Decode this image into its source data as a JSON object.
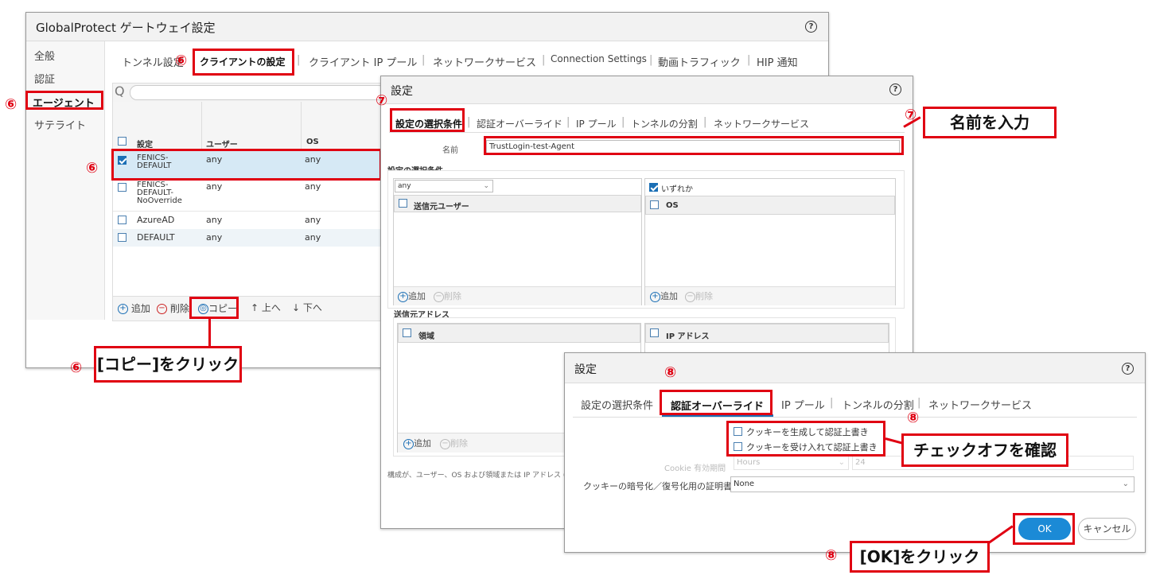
{
  "main_window": {
    "title": "GlobalProtect ゲートウェイ設定",
    "help": "?",
    "sidebar": [
      "全般",
      "認証",
      "エージェント",
      "サテライト"
    ],
    "tabs": [
      "トンネル設定",
      "クライアントの設定",
      "クライアント IP プール",
      "ネットワークサービス",
      "Connection Settings",
      "動画トラフィック",
      "HIP 通知"
    ],
    "table": {
      "headers": [
        "設定",
        "ユーザー",
        "OS"
      ],
      "rows": [
        {
          "name": "FENICS-\nDEFAULT",
          "user": "any",
          "os": "any",
          "checked": true
        },
        {
          "name": "FENICS-\nDEFAULT-\nNoOverride",
          "user": "any",
          "os": "any",
          "checked": false
        },
        {
          "name": "AzureAD",
          "user": "any",
          "os": "any",
          "checked": false
        },
        {
          "name": "DEFAULT",
          "user": "any",
          "os": "any",
          "checked": false
        }
      ]
    },
    "footer": {
      "add": "追加",
      "delete": "削除",
      "copy": "コピー",
      "up": "上へ",
      "down": "下へ"
    }
  },
  "settings_dialog": {
    "title": "設定",
    "tabs": [
      "設定の選択条件",
      "認証オーバーライド",
      "IP プール",
      "トンネルの分割",
      "ネットワークサービス"
    ],
    "name_label": "名前",
    "name_value": "TrustLogin-test-Agent",
    "section_selection": "設定の選択条件",
    "user_dropdown": "any",
    "any_checkbox": "いずれか",
    "source_user_header": "送信元ユーザー",
    "os_header": "OS",
    "add": "追加",
    "delete": "削除",
    "section_address": "送信元アドレス",
    "region_header": "領域",
    "ip_header": "IP アドレス",
    "bottom_note": "構成が、ユーザー、OS および領域または IP アドレス ("
  },
  "override_dialog": {
    "title": "設定",
    "tabs": [
      "設定の選択条件",
      "認証オーバーライド",
      "IP プール",
      "トンネルの分割",
      "ネットワークサービス"
    ],
    "cookie_generate": "クッキーを生成して認証上書き",
    "cookie_accept": "クッキーを受け入れて認証上書き",
    "cookie_lifetime_label": "Cookie 有効期間",
    "cookie_lifetime_unit": "Hours",
    "cookie_lifetime_value": "24",
    "cert_label": "クッキーの暗号化／復号化用の証明書",
    "cert_value": "None",
    "ok": "OK",
    "cancel": "キャンセル"
  },
  "annotations": {
    "n6": "⑥",
    "n7": "⑦",
    "n8": "⑧",
    "copy_click": "[コピー]をクリック",
    "enter_name": "名前を入力",
    "check_off": "チェックオフを確認",
    "ok_click": "[OK]をクリック"
  }
}
